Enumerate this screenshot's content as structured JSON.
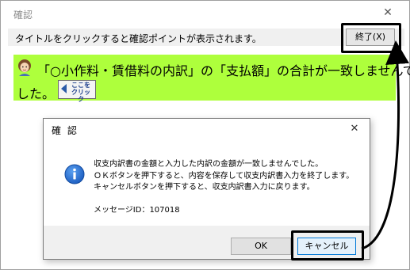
{
  "outer_window": {
    "title": "確認",
    "close_glyph": "✕"
  },
  "hint": {
    "text": "タイトルをクリックすると確認ポイントが表示されます。",
    "end_button": "終了(X)"
  },
  "banner": {
    "line1": "「○小作料・賃借料の内訳」の「支払額」の合計が一致しませんで",
    "line2": "した。",
    "click_button": "ここを\nクリック",
    "background": "#aeff3c"
  },
  "dialog": {
    "title": "確 認",
    "close_glyph": "✕",
    "icon": "info-icon",
    "messages": [
      "収支内訳書の金額と入力した内訳の金額が一致しませんでした。",
      "ＯＫボタンを押下すると、内容を保存して収支内訳書入力を終了します。",
      "キャンセルボタンを押下すると、収支内訳書入力に戻ります。"
    ],
    "message_id": "メッセージID：107018",
    "ok_button": "OK",
    "cancel_button": "キャンセル"
  }
}
